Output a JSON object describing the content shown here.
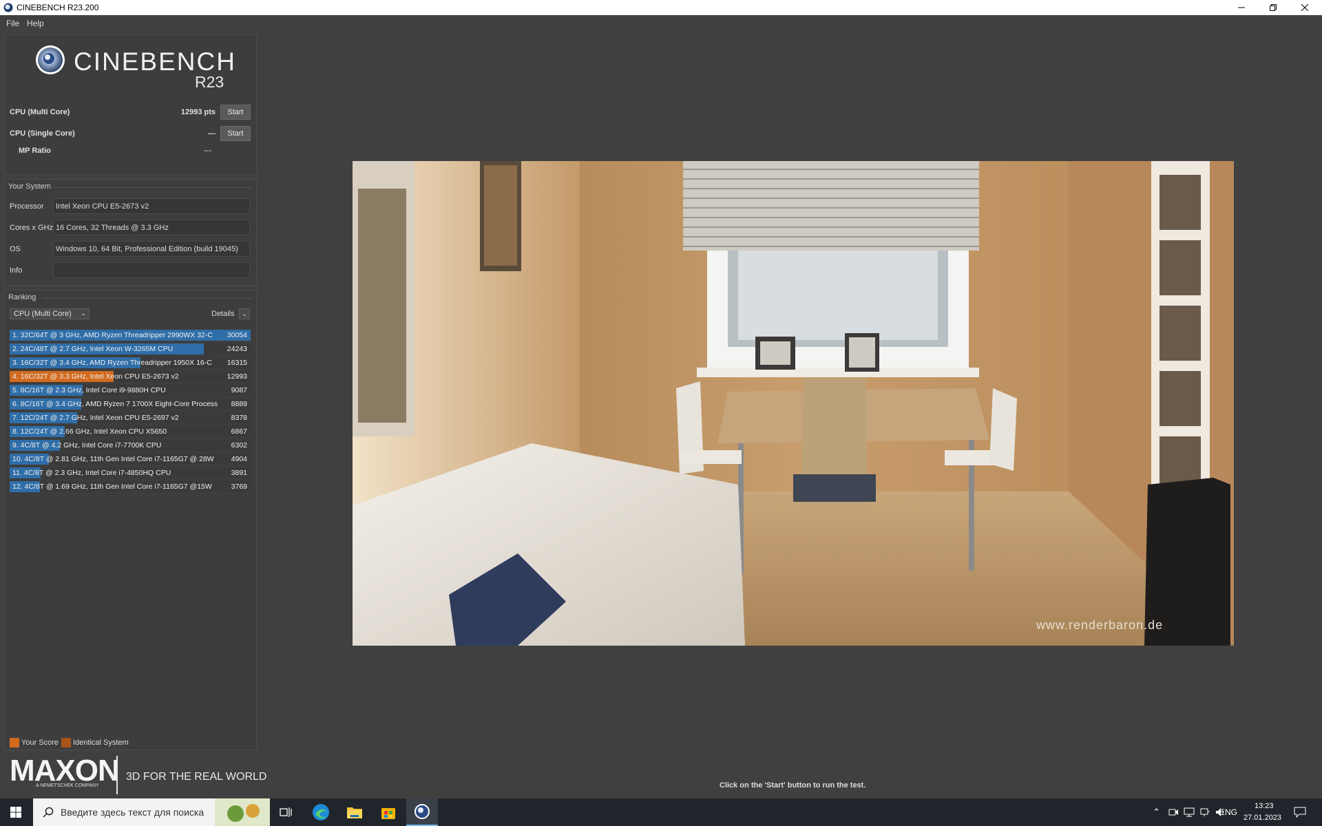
{
  "window": {
    "title": "CINEBENCH R23.200",
    "minimize_icon": "minimize-icon",
    "maximize_icon": "restore-icon",
    "close_icon": "close-icon"
  },
  "menu": {
    "file": "File",
    "help": "Help"
  },
  "logo": {
    "name": "CINEBENCH",
    "version": "R23"
  },
  "benchmarks": {
    "multi_label": "CPU (Multi Core)",
    "multi_value": "12993 pts",
    "single_label": "CPU (Single Core)",
    "single_value": "---",
    "ratio_label": "MP Ratio",
    "ratio_value": "---",
    "start_label": "Start"
  },
  "system": {
    "title": "Your System",
    "processor_label": "Processor",
    "processor_value": "Intel Xeon CPU E5-2673 v2",
    "cores_label": "Cores x GHz",
    "cores_value": "16 Cores, 32 Threads @ 3.3 GHz",
    "os_label": "OS",
    "os_value": "Windows 10, 64 Bit, Professional Edition (build 19045)",
    "info_label": "Info",
    "info_value": ""
  },
  "ranking": {
    "title": "Ranking",
    "dropdown_value": "CPU (Multi Core)",
    "details_label": "Details",
    "max_score": 30054,
    "items": [
      {
        "name": "1. 32C/64T @ 3 GHz, AMD Ryzen Threadripper 2990WX 32-C",
        "score": "30054",
        "value": 30054,
        "mine": false
      },
      {
        "name": "2. 24C/48T @ 2.7 GHz, Intel Xeon W-3265M CPU",
        "score": "24243",
        "value": 24243,
        "mine": false
      },
      {
        "name": "3. 16C/32T @ 3.4 GHz, AMD Ryzen Threadripper 1950X 16-C",
        "score": "16315",
        "value": 16315,
        "mine": false
      },
      {
        "name": "4. 16C/32T @ 3.3 GHz, Intel Xeon CPU E5-2673 v2",
        "score": "12993",
        "value": 12993,
        "mine": true
      },
      {
        "name": "5. 8C/16T @ 2.3 GHz, Intel Core i9-9880H CPU",
        "score": "9087",
        "value": 9087,
        "mine": false
      },
      {
        "name": "6. 8C/16T @ 3.4 GHz, AMD Ryzen 7 1700X Eight-Core Process",
        "score": "8889",
        "value": 8889,
        "mine": false
      },
      {
        "name": "7. 12C/24T @ 2.7 GHz, Intel Xeon CPU E5-2697 v2",
        "score": "8378",
        "value": 8378,
        "mine": false
      },
      {
        "name": "8. 12C/24T @ 2.66 GHz, Intel Xeon CPU X5650",
        "score": "6867",
        "value": 6867,
        "mine": false
      },
      {
        "name": "9. 4C/8T @ 4.2 GHz, Intel Core i7-7700K CPU",
        "score": "6302",
        "value": 6302,
        "mine": false
      },
      {
        "name": "10. 4C/8T @ 2.81 GHz, 11th Gen Intel Core i7-1165G7 @ 28W",
        "score": "4904",
        "value": 4904,
        "mine": false
      },
      {
        "name": "11. 4C/8T @ 2.3 GHz, Intel Core i7-4850HQ CPU",
        "score": "3891",
        "value": 3891,
        "mine": false
      },
      {
        "name": "12. 4C/8T @ 1.69 GHz, 11th Gen Intel Core i7-1165G7 @15W",
        "score": "3769",
        "value": 3769,
        "mine": false
      }
    ],
    "legend_your_score": "Your Score",
    "legend_identical": "Identical System"
  },
  "footer": {
    "brand": "MAXON",
    "brand_sub": "A NEMETSCHEK COMPANY",
    "tagline": "3D FOR THE REAL WORLD"
  },
  "render": {
    "watermark": "www.renderbaron.de"
  },
  "status": "Click on the 'Start' button to run the test.",
  "taskbar": {
    "search_placeholder": "Введите здесь текст для поиска",
    "lang": "ENG",
    "time": "13:23",
    "date": "27.01.2023"
  },
  "colors": {
    "your_score": "#d26a1f",
    "identical_system": "#a8541a",
    "rank_bar": "#2f6ea8"
  }
}
